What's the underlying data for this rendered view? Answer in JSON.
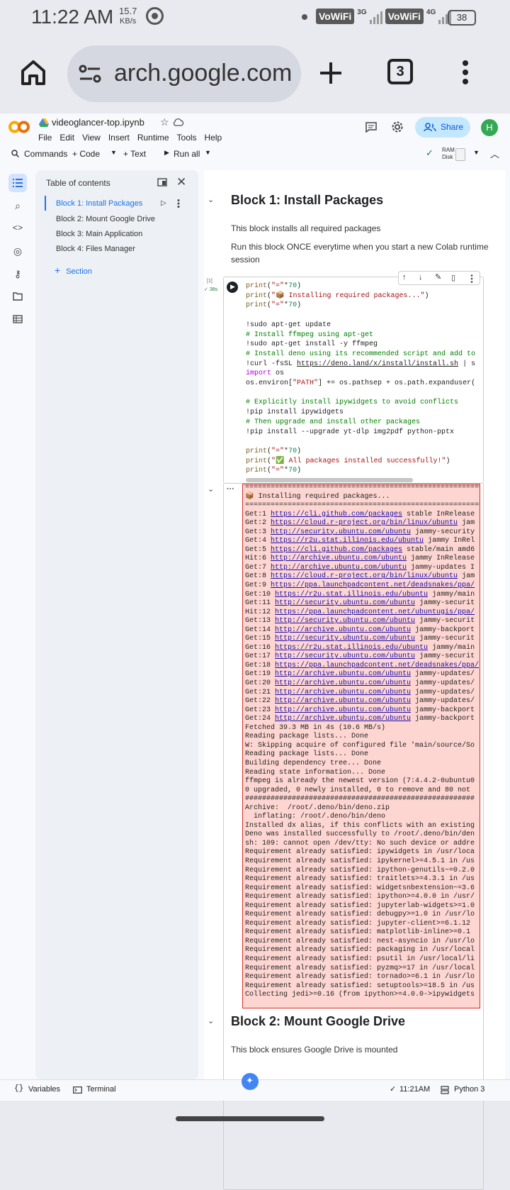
{
  "status": {
    "time": "11:22 AM",
    "speed": "15.7",
    "speed_unit": "KB/s",
    "vowifi1": "VoWiFi",
    "net1": "3G",
    "vowifi2": "VoWiFi",
    "net2": "4G",
    "battery": "38"
  },
  "browser": {
    "url": "arch.google.com",
    "tabs_count": "3"
  },
  "colab": {
    "title": "videoglancer-top.ipynb",
    "menu": [
      "File",
      "Edit",
      "View",
      "Insert",
      "Runtime",
      "Tools",
      "Help"
    ],
    "share": "Share",
    "avatar": "H",
    "toolbar": {
      "commands": "Commands",
      "code": "+ Code",
      "text": "+ Text",
      "run_all": "Run all",
      "ram": "RAM",
      "disk": "Disk"
    }
  },
  "toc": {
    "title": "Table of contents",
    "items": [
      "Block 1: Install Packages",
      "Block 2: Mount Google Drive",
      "Block 3: Main Application",
      "Block 4: Files Manager"
    ],
    "add_section": "Section"
  },
  "notebook": {
    "block1": {
      "heading": "Block 1: Install Packages",
      "p1": "This block installs all required packages",
      "p2": "Run this block ONCE everytime when you start a new Colab runtime session"
    },
    "cell": {
      "exec": "[1]",
      "time": "38s"
    },
    "block2": {
      "heading": "Block 2: Mount Google Drive",
      "p1": "This block ensures Google Drive is mounted"
    }
  },
  "bottom": {
    "variables": "Variables",
    "terminal": "Terminal",
    "time": "11:21AM",
    "kernel": "Python 3"
  },
  "colors": {
    "accent": "#1a73e8",
    "output_bg": "#fdd6d2",
    "output_border": "#d93025",
    "avatar": "#34a853"
  }
}
